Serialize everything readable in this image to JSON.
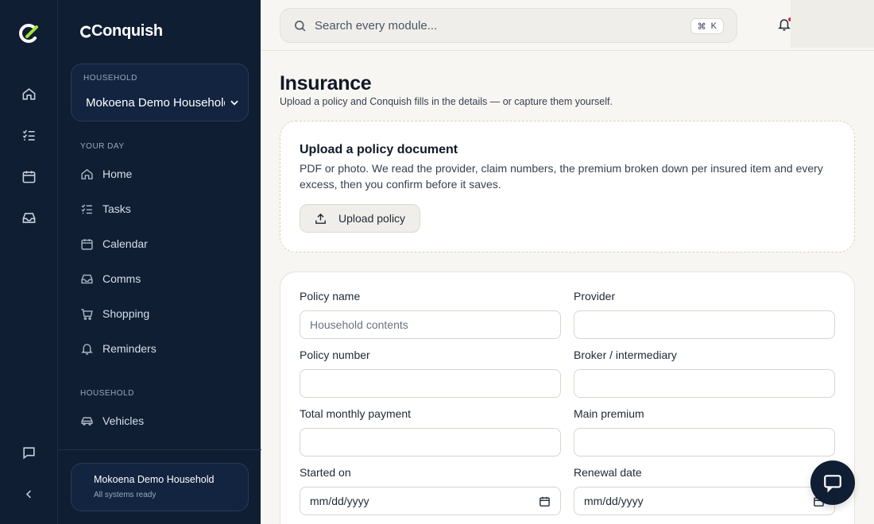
{
  "brand": {
    "name": "Conquish"
  },
  "household_switcher": {
    "label": "HOUSEHOLD",
    "value": "Mokoena Demo Household"
  },
  "nav": {
    "sections": [
      {
        "label": "YOUR DAY"
      },
      {
        "label": "HOUSEHOLD"
      }
    ],
    "items": [
      {
        "label": "Home",
        "icon": "home-icon"
      },
      {
        "label": "Tasks",
        "icon": "tasks-icon"
      },
      {
        "label": "Calendar",
        "icon": "calendar-icon"
      },
      {
        "label": "Comms",
        "icon": "inbox-icon"
      },
      {
        "label": "Shopping",
        "icon": "cart-icon"
      },
      {
        "label": "Reminders",
        "icon": "bell-icon"
      },
      {
        "label": "Vehicles",
        "icon": "car-icon"
      }
    ]
  },
  "status": {
    "title": "Mokoena Demo Household",
    "subtitle": "All systems ready"
  },
  "search": {
    "placeholder": "Search every module...",
    "shortcut_symbol": "⌘",
    "shortcut_key": "K"
  },
  "page": {
    "title": "Insurance",
    "subtitle": "Upload a policy and Conquish fills in the details — or capture them yourself."
  },
  "upload": {
    "title": "Upload a policy document",
    "description": "PDF or photo. We read the provider, claim numbers, the premium broken down per insured item and every excess, then you confirm before it saves.",
    "button_label": "Upload policy"
  },
  "form": {
    "policy_name": {
      "label": "Policy name",
      "placeholder": "Household contents",
      "value": ""
    },
    "provider": {
      "label": "Provider",
      "value": ""
    },
    "policy_number": {
      "label": "Policy number",
      "value": ""
    },
    "broker": {
      "label": "Broker / intermediary",
      "value": ""
    },
    "total_monthly": {
      "label": "Total monthly payment",
      "value": ""
    },
    "main_premium": {
      "label": "Main premium",
      "value": ""
    },
    "started_on": {
      "label": "Started on",
      "value": "mm/dd/yyyy"
    },
    "renewal_date": {
      "label": "Renewal date",
      "value": "mm/dd/yyyy"
    }
  },
  "colors": {
    "sidebar_bg": "#0f1e33",
    "page_bg": "#f7f6f2",
    "accent_red": "#e11d48"
  }
}
